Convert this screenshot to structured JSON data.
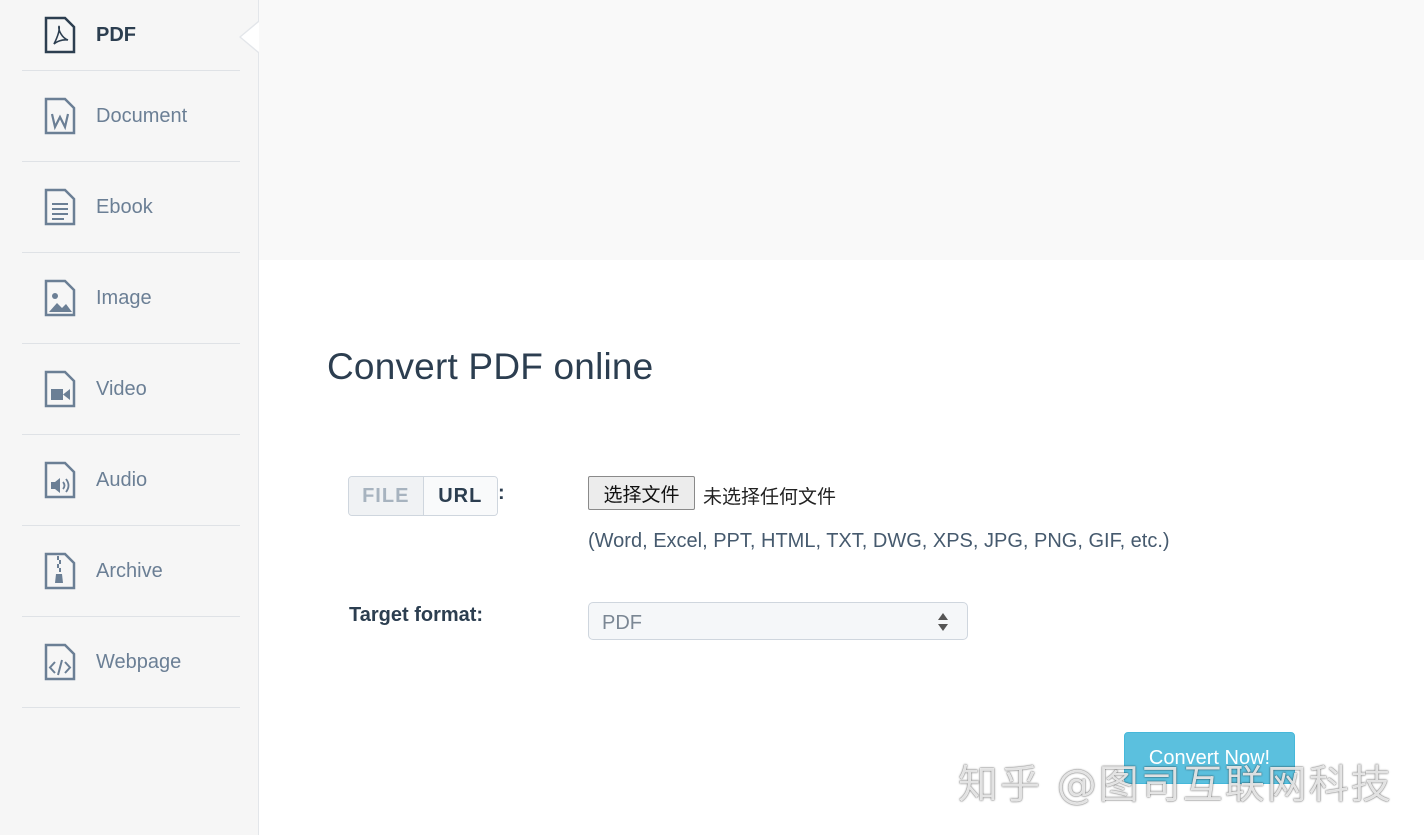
{
  "sidebar": {
    "items": [
      {
        "label": "PDF",
        "icon": "pdf-file-icon",
        "active": true
      },
      {
        "label": "Document",
        "icon": "word-file-icon"
      },
      {
        "label": "Ebook",
        "icon": "ebook-file-icon"
      },
      {
        "label": "Image",
        "icon": "image-file-icon"
      },
      {
        "label": "Video",
        "icon": "video-file-icon"
      },
      {
        "label": "Audio",
        "icon": "audio-file-icon"
      },
      {
        "label": "Archive",
        "icon": "archive-file-icon"
      },
      {
        "label": "Webpage",
        "icon": "code-file-icon"
      }
    ]
  },
  "main": {
    "title": "Convert PDF online",
    "source_toggle": {
      "file_label": "FILE",
      "url_label": "URL",
      "colon": ":"
    },
    "file_input": {
      "button_label": "选择文件",
      "status_text": "未选择任何文件"
    },
    "formats_hint": "(Word, Excel, PPT, HTML, TXT, DWG, XPS, JPG, PNG, GIF, etc.)",
    "target": {
      "label": "Target format:",
      "selected": "PDF"
    },
    "convert_label": "Convert Now!"
  },
  "watermark": "知乎 @图司互联网科技",
  "colors": {
    "accent": "#5bc0de",
    "sidebar_bg": "#f6f6f6",
    "text": "#2c3e50"
  }
}
